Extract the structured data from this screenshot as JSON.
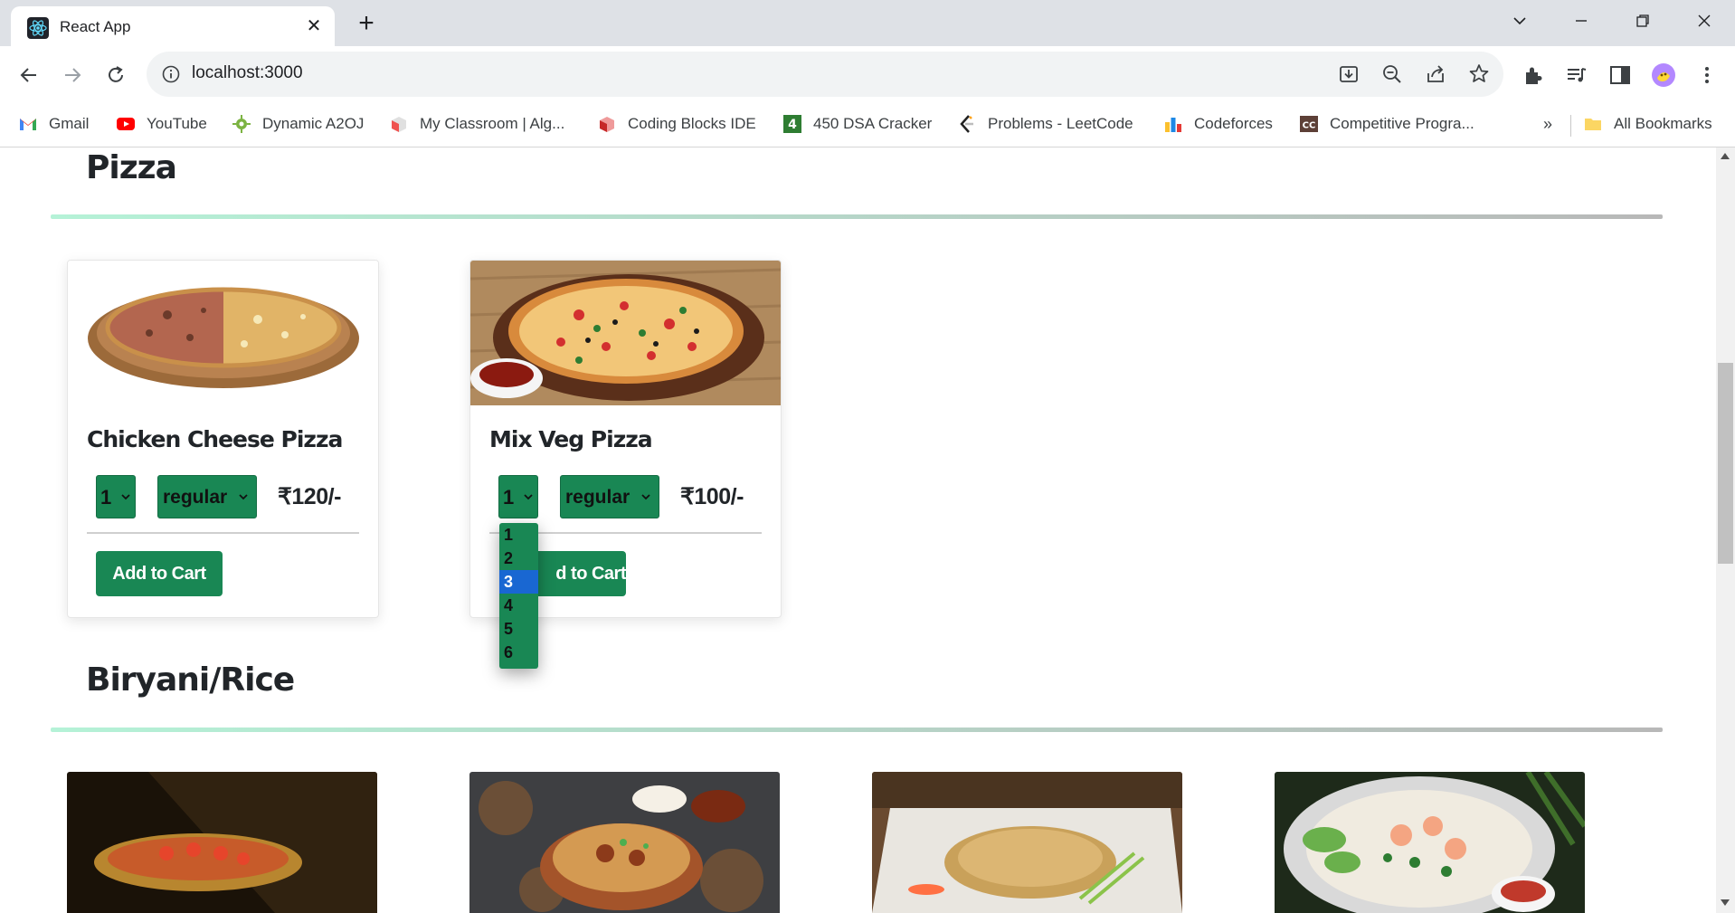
{
  "browser": {
    "tab_title": "React App",
    "url": "localhost:3000",
    "bookmarks": [
      {
        "label": "Gmail",
        "icon": "gmail-icon"
      },
      {
        "label": "YouTube",
        "icon": "youtube-icon"
      },
      {
        "label": "Dynamic A2OJ",
        "icon": "a2oj-icon"
      },
      {
        "label": "My Classroom | Alg...",
        "icon": "classroom-icon"
      },
      {
        "label": "Coding Blocks IDE",
        "icon": "codingblocks-icon"
      },
      {
        "label": "450 DSA Cracker",
        "icon": "dsa-cracker-icon"
      },
      {
        "label": "Problems - LeetCode",
        "icon": "leetcode-icon"
      },
      {
        "label": "Codeforces",
        "icon": "codeforces-icon"
      },
      {
        "label": "Competitive Progra...",
        "icon": "cc-icon"
      }
    ],
    "more_bookmarks": "»",
    "all_bookmarks": "All Bookmarks"
  },
  "sections": [
    {
      "title": "Pizza"
    },
    {
      "title": "Biryani/Rice"
    }
  ],
  "cards": [
    {
      "name": "Chicken Cheese Pizza",
      "qty": "1",
      "size": "regular",
      "price": "₹120/-",
      "button": "Add to Cart"
    },
    {
      "name": "Mix Veg Pizza",
      "qty": "1",
      "size": "regular",
      "price": "₹100/-",
      "button": "d to Cart"
    }
  ],
  "qty_dropdown": {
    "options": [
      "1",
      "2",
      "3",
      "4",
      "5",
      "6"
    ],
    "highlighted": "3"
  },
  "colors": {
    "accent_green": "#198754",
    "highlight_blue": "#1967d2"
  }
}
